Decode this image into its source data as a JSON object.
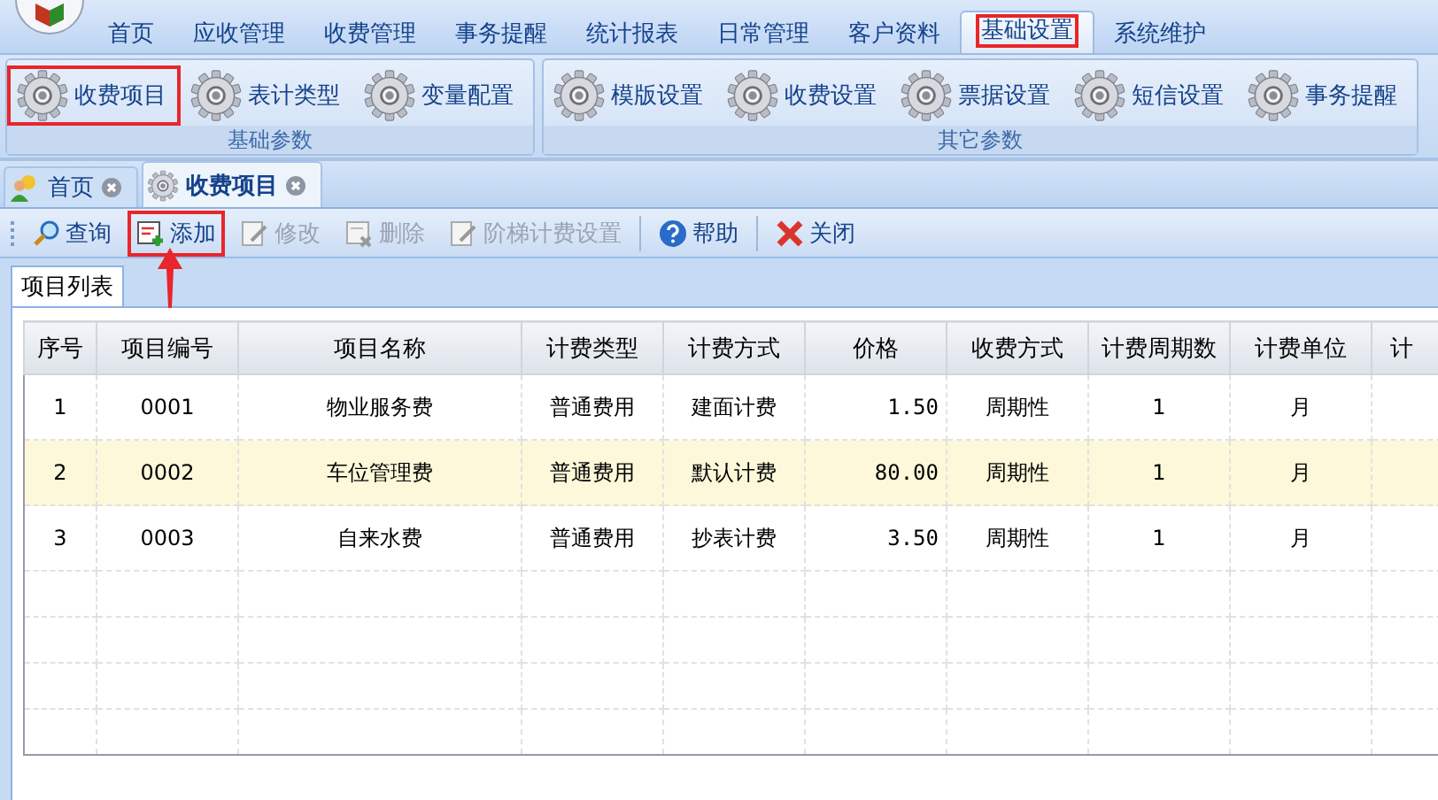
{
  "menu": {
    "items": [
      {
        "label": "首页",
        "selected": false,
        "highlighted": false
      },
      {
        "label": "应收管理",
        "selected": false,
        "highlighted": false
      },
      {
        "label": "收费管理",
        "selected": false,
        "highlighted": false
      },
      {
        "label": "事务提醒",
        "selected": false,
        "highlighted": false
      },
      {
        "label": "统计报表",
        "selected": false,
        "highlighted": false
      },
      {
        "label": "日常管理",
        "selected": false,
        "highlighted": false
      },
      {
        "label": "客户资料",
        "selected": false,
        "highlighted": false
      },
      {
        "label": "基础设置",
        "selected": true,
        "highlighted": true
      },
      {
        "label": "系统维护",
        "selected": false,
        "highlighted": false
      }
    ]
  },
  "ribbon": {
    "groups": [
      {
        "label": "基础参数",
        "buttons": [
          {
            "label": "收费项目",
            "highlighted": true
          },
          {
            "label": "表计类型",
            "highlighted": false
          },
          {
            "label": "变量配置",
            "highlighted": false
          }
        ]
      },
      {
        "label": "其它参数",
        "buttons": [
          {
            "label": "模版设置",
            "highlighted": false
          },
          {
            "label": "收费设置",
            "highlighted": false
          },
          {
            "label": "票据设置",
            "highlighted": false
          },
          {
            "label": "短信设置",
            "highlighted": false
          },
          {
            "label": "事务提醒",
            "highlighted": false
          }
        ]
      }
    ]
  },
  "doc_tabs": [
    {
      "label": "首页",
      "selected": false
    },
    {
      "label": "收费项目",
      "selected": true
    }
  ],
  "toolbar": [
    {
      "label": "查询",
      "kind": "search",
      "disabled": false,
      "highlighted": false
    },
    {
      "label": "添加",
      "kind": "add",
      "disabled": false,
      "highlighted": true
    },
    {
      "label": "修改",
      "kind": "edit",
      "disabled": true,
      "highlighted": false
    },
    {
      "label": "删除",
      "kind": "delete",
      "disabled": true,
      "highlighted": false
    },
    {
      "label": "阶梯计费设置",
      "kind": "edit",
      "disabled": true,
      "highlighted": false
    },
    {
      "kind": "separator"
    },
    {
      "label": "帮助",
      "kind": "help",
      "disabled": false,
      "highlighted": false
    },
    {
      "kind": "separator"
    },
    {
      "label": "关闭",
      "kind": "close",
      "disabled": false,
      "highlighted": false
    }
  ],
  "subtab": {
    "label": "项目列表"
  },
  "grid": {
    "columns": [
      {
        "label": "序号",
        "kind": "text"
      },
      {
        "label": "项目编号",
        "kind": "text"
      },
      {
        "label": "项目名称",
        "kind": "text"
      },
      {
        "label": "计费类型",
        "kind": "text"
      },
      {
        "label": "计费方式",
        "kind": "text"
      },
      {
        "label": "价格",
        "kind": "number"
      },
      {
        "label": "收费方式",
        "kind": "text"
      },
      {
        "label": "计费周期数",
        "kind": "text"
      },
      {
        "label": "计费单位",
        "kind": "text"
      },
      {
        "label": "计",
        "kind": "text"
      }
    ],
    "rows": [
      {
        "selected": false,
        "cells": [
          "1",
          "0001",
          "物业服务费",
          "普通费用",
          "建面计费",
          "1.50",
          "周期性",
          "1",
          "月"
        ]
      },
      {
        "selected": true,
        "cells": [
          "2",
          "0002",
          "车位管理费",
          "普通费用",
          "默认计费",
          "80.00",
          "周期性",
          "1",
          "月"
        ]
      },
      {
        "selected": false,
        "cells": [
          "3",
          "0003",
          "自来水费",
          "普通费用",
          "抄表计费",
          "3.50",
          "周期性",
          "1",
          "月"
        ]
      }
    ]
  }
}
